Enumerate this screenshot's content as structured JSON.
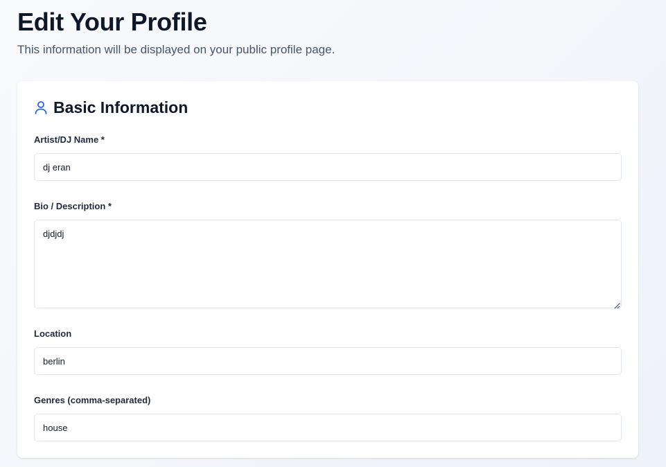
{
  "header": {
    "title": "Edit Your Profile",
    "subtitle": "This information will be displayed on your public profile page."
  },
  "basic_info": {
    "icon": "user-icon",
    "title": "Basic Information",
    "accent_color": "#2563eb",
    "fields": {
      "artist_name": {
        "label": "Artist/DJ Name *",
        "value": "dj eran"
      },
      "bio": {
        "label": "Bio / Description *",
        "value": "djdjdj"
      },
      "location": {
        "label": "Location",
        "value": "berlin"
      },
      "genres": {
        "label": "Genres (comma-separated)",
        "value": "house"
      }
    }
  }
}
